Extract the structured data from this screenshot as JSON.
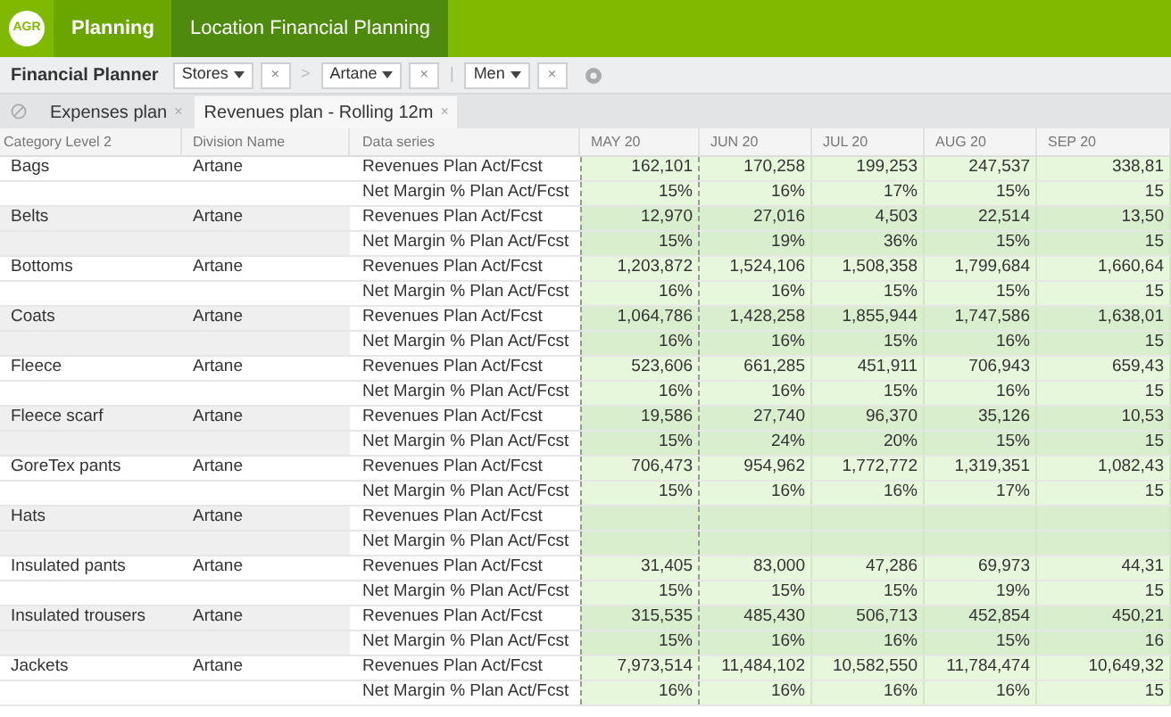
{
  "app_bar": {
    "logo": "AGR",
    "tabs": [
      {
        "label": "Planning",
        "selected": false
      },
      {
        "label": "Location Financial Planning",
        "selected": true
      }
    ]
  },
  "toolbar": {
    "title": "Financial Planner",
    "filters": [
      {
        "label": "Stores",
        "clear": "×",
        "separator": ">"
      },
      {
        "label": "Artane",
        "clear": "×",
        "separator": "|"
      },
      {
        "label": "Men",
        "clear": "×"
      }
    ]
  },
  "doc_tabs": [
    {
      "label": "Expenses plan",
      "close": "×",
      "selected": false
    },
    {
      "label": "Revenues plan - Rolling 12m",
      "close": "×",
      "selected": true
    }
  ],
  "table": {
    "columns": [
      "Category Level 2",
      "Division Name",
      "Data series",
      "MAY 20",
      "JUN 20",
      "JUL 20",
      "AUG 20",
      "SEP 20"
    ],
    "groups": [
      {
        "category": "Bags",
        "division": "Artane",
        "series": [
          {
            "name": "Revenues Plan Act/Fcst",
            "values": [
              "162,101",
              "170,258",
              "199,253",
              "247,537",
              "338,81"
            ]
          },
          {
            "name": "Net Margin % Plan Act/Fcst",
            "values": [
              "15%",
              "16%",
              "17%",
              "15%",
              "15"
            ]
          }
        ]
      },
      {
        "category": "Belts",
        "division": "Artane",
        "series": [
          {
            "name": "Revenues Plan Act/Fcst",
            "values": [
              "12,970",
              "27,016",
              "4,503",
              "22,514",
              "13,50"
            ]
          },
          {
            "name": "Net Margin % Plan Act/Fcst",
            "values": [
              "15%",
              "19%",
              "36%",
              "15%",
              "15"
            ]
          }
        ]
      },
      {
        "category": "Bottoms",
        "division": "Artane",
        "series": [
          {
            "name": "Revenues Plan Act/Fcst",
            "values": [
              "1,203,872",
              "1,524,106",
              "1,508,358",
              "1,799,684",
              "1,660,64"
            ]
          },
          {
            "name": "Net Margin % Plan Act/Fcst",
            "values": [
              "16%",
              "16%",
              "15%",
              "15%",
              "15"
            ]
          }
        ]
      },
      {
        "category": "Coats",
        "division": "Artane",
        "series": [
          {
            "name": "Revenues Plan Act/Fcst",
            "values": [
              "1,064,786",
              "1,428,258",
              "1,855,944",
              "1,747,586",
              "1,638,01"
            ]
          },
          {
            "name": "Net Margin % Plan Act/Fcst",
            "values": [
              "16%",
              "16%",
              "15%",
              "16%",
              "15"
            ]
          }
        ]
      },
      {
        "category": "Fleece",
        "division": "Artane",
        "series": [
          {
            "name": "Revenues Plan Act/Fcst",
            "values": [
              "523,606",
              "661,285",
              "451,911",
              "706,943",
              "659,43"
            ]
          },
          {
            "name": "Net Margin % Plan Act/Fcst",
            "values": [
              "16%",
              "16%",
              "15%",
              "16%",
              "15"
            ]
          }
        ]
      },
      {
        "category": "Fleece scarf",
        "division": "Artane",
        "series": [
          {
            "name": "Revenues Plan Act/Fcst",
            "values": [
              "19,586",
              "27,740",
              "96,370",
              "35,126",
              "10,53"
            ]
          },
          {
            "name": "Net Margin % Plan Act/Fcst",
            "values": [
              "15%",
              "24%",
              "20%",
              "15%",
              "15"
            ]
          }
        ]
      },
      {
        "category": "GoreTex pants",
        "division": "Artane",
        "series": [
          {
            "name": "Revenues Plan Act/Fcst",
            "values": [
              "706,473",
              "954,962",
              "1,772,772",
              "1,319,351",
              "1,082,43"
            ]
          },
          {
            "name": "Net Margin % Plan Act/Fcst",
            "values": [
              "15%",
              "16%",
              "16%",
              "17%",
              "15"
            ]
          }
        ]
      },
      {
        "category": "Hats",
        "division": "Artane",
        "series": [
          {
            "name": "Revenues Plan Act/Fcst"
          },
          {
            "name": "Net Margin % Plan Act/Fcst"
          }
        ]
      },
      {
        "category": "Insulated pants",
        "division": "Artane",
        "series": [
          {
            "name": "Revenues Plan Act/Fcst",
            "values": [
              "31,405",
              "83,000",
              "47,286",
              "69,973",
              "44,31"
            ]
          },
          {
            "name": "Net Margin % Plan Act/Fcst",
            "values": [
              "15%",
              "15%",
              "15%",
              "19%",
              "15"
            ]
          }
        ]
      },
      {
        "category": "Insulated trousers",
        "division": "Artane",
        "series": [
          {
            "name": "Revenues Plan Act/Fcst",
            "values": [
              "315,535",
              "485,430",
              "506,713",
              "452,854",
              "450,21"
            ]
          },
          {
            "name": "Net Margin % Plan Act/Fcst",
            "values": [
              "15%",
              "16%",
              "16%",
              "15%",
              "16"
            ]
          }
        ]
      },
      {
        "category": "Jackets",
        "division": "Artane",
        "series": [
          {
            "name": "Revenues Plan Act/Fcst",
            "values": [
              "7,973,514",
              "11,484,102",
              "10,582,550",
              "11,784,474",
              "10,649,32"
            ]
          },
          {
            "name": "Net Margin % Plan Act/Fcst",
            "values": [
              "16%",
              "16%",
              "16%",
              "16%",
              "15"
            ]
          }
        ]
      }
    ]
  }
}
